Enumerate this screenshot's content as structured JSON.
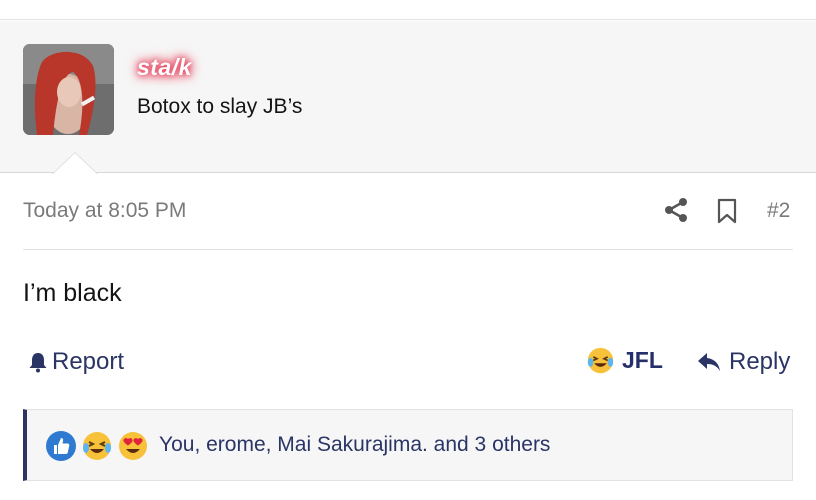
{
  "author": {
    "username": "sta/k",
    "title": "Botox to slay JB’s",
    "avatar_icon": "avatar-photo"
  },
  "post": {
    "date": "Today at 8:05 PM",
    "number": "#2",
    "body": "I’m black",
    "share_icon": "share-icon",
    "bookmark_icon": "bookmark-icon"
  },
  "actions": {
    "report_label": "Report",
    "jfl_label": "JFL",
    "reply_label": "Reply"
  },
  "reactions": {
    "summary": "You, erome, Mai Sakurajima. and 3 others",
    "icons": [
      "like-icon",
      "jfl-laughing-icon",
      "heart-eyes-icon"
    ]
  },
  "colors": {
    "accent": "#2a3566",
    "username_glow": "#e4324e",
    "muted": "#7a7a7a",
    "panel_bg": "#f6f6f6"
  }
}
